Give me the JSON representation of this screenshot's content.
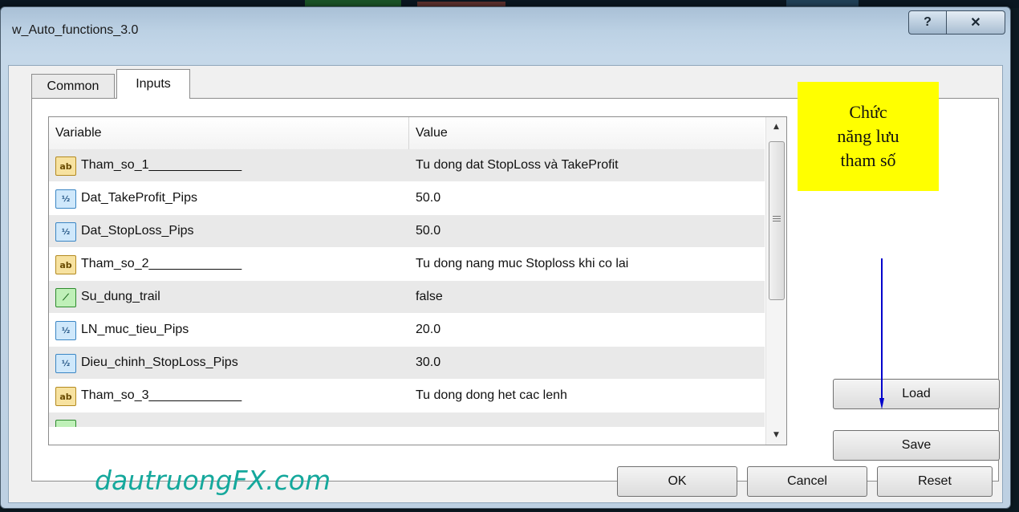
{
  "window": {
    "title": "w_Auto_functions_3.0",
    "help_label": "?",
    "close_label": "✕"
  },
  "tabs": [
    {
      "label": "Common"
    },
    {
      "label": "Inputs"
    }
  ],
  "grid": {
    "headers": {
      "variable": "Variable",
      "value": "Value"
    },
    "rows": [
      {
        "icon": "ab",
        "variable": "Tham_so_1_____________",
        "value": "Tu dong dat StopLoss và TakeProfit"
      },
      {
        "icon": "½",
        "variable": "Dat_TakeProfit_Pips",
        "value": "50.0"
      },
      {
        "icon": "½",
        "variable": "Dat_StopLoss_Pips",
        "value": "50.0"
      },
      {
        "icon": "ab",
        "variable": "Tham_so_2_____________",
        "value": "Tu dong nang muc Stoploss khi co lai"
      },
      {
        "icon": "⟋",
        "variable": "Su_dung_trail",
        "value": "false"
      },
      {
        "icon": "½",
        "variable": "LN_muc_tieu_Pips",
        "value": "20.0"
      },
      {
        "icon": "½",
        "variable": "Dieu_chinh_StopLoss_Pips",
        "value": "30.0"
      },
      {
        "icon": "ab",
        "variable": "Tham_so_3_____________",
        "value": "Tu dong dong het cac lenh"
      }
    ]
  },
  "scrollbar": {
    "up": "▲",
    "down": "▼"
  },
  "annotation": {
    "line1": "Chức",
    "line2": "năng lưu",
    "line3": "tham số"
  },
  "side_buttons": {
    "load": "Load",
    "save": "Save"
  },
  "bottom_buttons": {
    "ok": "OK",
    "cancel": "Cancel",
    "reset": "Reset"
  },
  "watermark": "dautruongFX.com",
  "colors": {
    "note_bg": "#ffff00",
    "arrow": "#0000cc",
    "watermark": "#15a89c"
  }
}
